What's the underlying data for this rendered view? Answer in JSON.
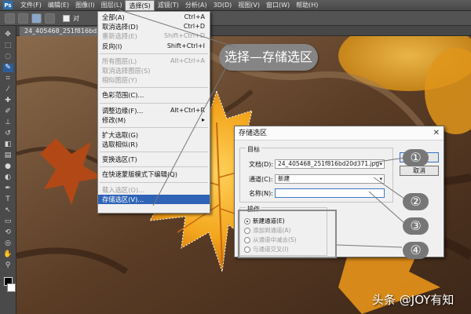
{
  "menubar": {
    "logo": "Ps",
    "items": [
      "文件(F)",
      "编辑(E)",
      "图像(I)",
      "图层(L)",
      "选择(S)",
      "滤镜(T)",
      "分析(A)",
      "3D(D)",
      "视图(V)",
      "窗口(W)",
      "帮助(H)"
    ],
    "active_index": 4
  },
  "optbar": {
    "checkbox_label": "对"
  },
  "document": {
    "tab_title": "24_405468_251f816bd20d371.jp..."
  },
  "select_menu": {
    "items": [
      {
        "label": "全部(A)",
        "shortcut": "Ctrl+A",
        "disabled": false
      },
      {
        "label": "取消选择(D)",
        "shortcut": "Ctrl+D",
        "disabled": false
      },
      {
        "label": "重新选择(E)",
        "shortcut": "Shift+Ctrl+D",
        "disabled": true
      },
      {
        "label": "反向(I)",
        "shortcut": "Shift+Ctrl+I",
        "disabled": false
      },
      {
        "sep": true
      },
      {
        "label": "所有图层(L)",
        "shortcut": "Alt+Ctrl+A",
        "disabled": true
      },
      {
        "label": "取消选择图层(S)",
        "shortcut": "",
        "disabled": true
      },
      {
        "label": "相似图层(Y)",
        "shortcut": "",
        "disabled": true
      },
      {
        "sep": true
      },
      {
        "label": "色彩范围(C)...",
        "shortcut": "",
        "disabled": false
      },
      {
        "sep": true
      },
      {
        "label": "调整边缘(F)...",
        "shortcut": "Alt+Ctrl+R",
        "disabled": false
      },
      {
        "label": "修改(M)",
        "shortcut": "▸",
        "disabled": false
      },
      {
        "sep": true
      },
      {
        "label": "扩大选取(G)",
        "shortcut": "",
        "disabled": false
      },
      {
        "label": "选取相似(R)",
        "shortcut": "",
        "disabled": false
      },
      {
        "sep": true
      },
      {
        "label": "变换选区(T)",
        "shortcut": "",
        "disabled": false
      },
      {
        "sep": true
      },
      {
        "label": "在快速蒙版模式下编辑(Q)",
        "shortcut": "",
        "disabled": false
      },
      {
        "sep": true
      },
      {
        "label": "载入选区(O)...",
        "shortcut": "",
        "disabled": true
      },
      {
        "label": "存储选区(V)...",
        "shortcut": "",
        "disabled": false,
        "highlight": true
      }
    ]
  },
  "callout": "选择—存储选区",
  "dialog": {
    "title": "存储选区",
    "close": "✕",
    "group_destination": "目标",
    "doc_label": "文档(D):",
    "doc_value": "24_405468_251f816bd20d371.jpg",
    "channel_label": "通道(C):",
    "channel_value": "新建",
    "name_label": "名称(N):",
    "name_value": "",
    "ok": "确定",
    "cancel": "取消",
    "group_operation": "操作",
    "operations": [
      {
        "label": "新建通道(E)",
        "selected": true,
        "disabled": false
      },
      {
        "label": "添加到通道(A)",
        "selected": false,
        "disabled": true
      },
      {
        "label": "从通道中减去(S)",
        "selected": false,
        "disabled": true
      },
      {
        "label": "与通道交叉(I)",
        "selected": false,
        "disabled": true
      }
    ]
  },
  "markers": [
    "①",
    "②",
    "③",
    "④"
  ],
  "watermark": "头条 @JOY有知",
  "colors": {
    "accent": "#2f63b6",
    "callout": "#858585",
    "leaf": "#f2a31b"
  }
}
